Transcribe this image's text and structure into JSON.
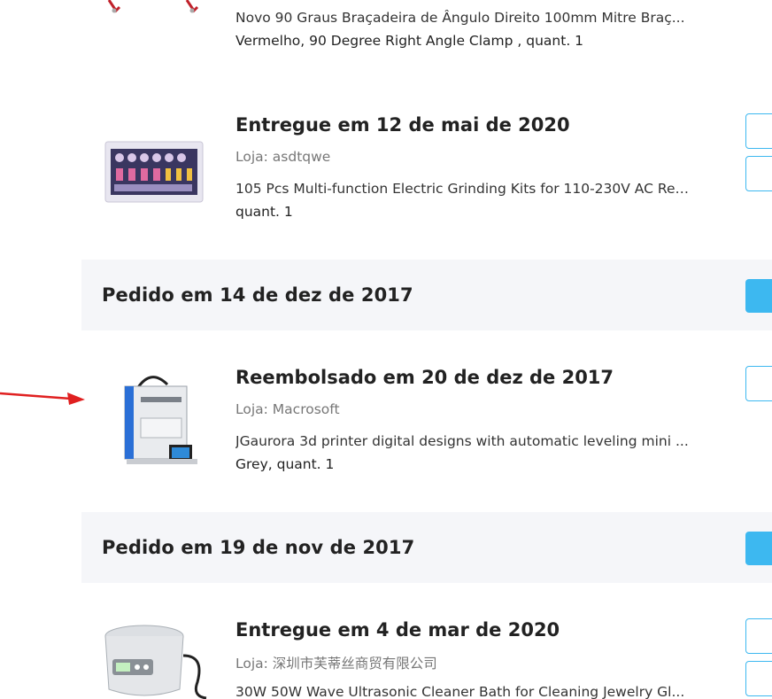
{
  "orders": [
    {
      "order_date": "",
      "items": [
        {
          "status": "",
          "store": "",
          "name": "Novo 90 Graus Braçadeira de Ângulo Direito 100mm Mitre Braç...",
          "variant": "Vermelho, 90 Degree Right Angle Clamp , quant. 1",
          "icon": "clamp-thumbnail"
        },
        {
          "status": "Entregue em 12 de mai de 2020",
          "store": "Loja: asdtqwe",
          "name": "105 Pcs Multi-function Electric Grinding Kits for 110-230V AC Reg...",
          "variant": "quant. 1",
          "icon": "grinding-kit-thumbnail"
        }
      ]
    },
    {
      "order_date": "Pedido em 14 de dez de 2017",
      "items": [
        {
          "status": "Reembolsado em 20 de dez de 2017",
          "store": "Loja: Macrosoft",
          "name": "JGaurora 3d printer digital designs with automatic leveling mini ...",
          "variant": "Grey, quant. 1",
          "icon": "3d-printer-thumbnail"
        }
      ]
    },
    {
      "order_date": "Pedido em 19 de nov de 2017",
      "items": [
        {
          "status": "Entregue em 4 de mar de 2020",
          "store": "Loja: 深圳市芙蒂丝商贸有限公司",
          "name": "30W 50W Wave Ultrasonic Cleaner Bath for Cleaning Jewelry Gl...",
          "variant": "",
          "icon": "ultrasonic-cleaner-thumbnail"
        }
      ]
    }
  ],
  "colors": {
    "accent": "#3db8f0",
    "header_bg": "#f5f6f9",
    "annotation_arrow": "#e02020"
  }
}
